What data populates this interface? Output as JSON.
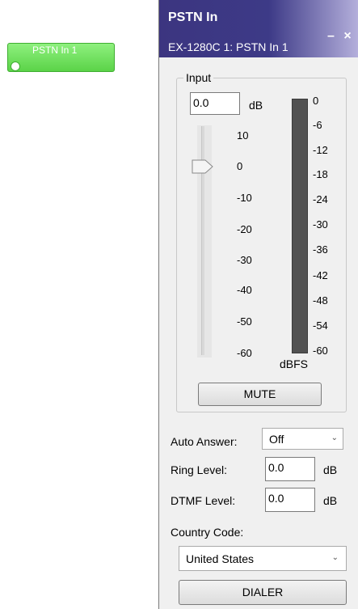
{
  "canvas_block": {
    "label": "PSTN In 1"
  },
  "window": {
    "title": "PSTN In",
    "subtitle": "EX-1280C 1: PSTN In 1",
    "minimize_label": "–",
    "close_label": "×"
  },
  "input": {
    "group_label": "Input",
    "gain_value": "0.0",
    "gain_unit": "dB",
    "fader_scale": [
      "10",
      "0",
      "-10",
      "-20",
      "-30",
      "-40",
      "-50",
      "-60"
    ],
    "fader_position_db": 0,
    "meter_scale": [
      "0",
      "-6",
      "-12",
      "-18",
      "-24",
      "-30",
      "-36",
      "-42",
      "-48",
      "-54",
      "-60"
    ],
    "meter_unit": "dBFS",
    "mute_label": "MUTE"
  },
  "auto_answer": {
    "label": "Auto Answer:",
    "value": "Off"
  },
  "ring_level": {
    "label": "Ring Level:",
    "value": "0.0",
    "unit": "dB"
  },
  "dtmf_level": {
    "label": "DTMF Level:",
    "value": "0.0",
    "unit": "dB"
  },
  "country_code": {
    "label": "Country Code:",
    "value": "United States"
  },
  "dialer_label": "DIALER"
}
